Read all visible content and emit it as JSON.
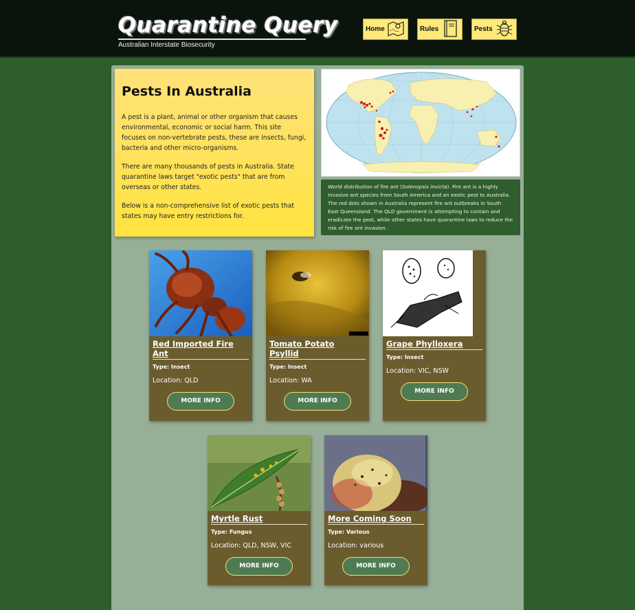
{
  "header": {
    "title": "Quarantine Query",
    "subtitle": "Australian Interstate Biosecurity",
    "nav": [
      {
        "label": "Home",
        "icon": "map-icon"
      },
      {
        "label": "Rules",
        "icon": "book-icon"
      },
      {
        "label": "Pests",
        "icon": "bug-icon"
      }
    ]
  },
  "intro": {
    "heading": "Pests In Australia",
    "paragraphs": [
      "A pest is a plant, animal or other organism that causes environmental, economic or social harm. This site focuses on non-vertebrate pests, these are insects, fungi, bacteria and other micro-organisms.",
      "There are many thousands of pests in Australia. State quarantine laws target \"exotic pests\" that are from overseas or other states.",
      "Below is a non-comprehensive list of exotic pests that states may have entry restrictions for."
    ]
  },
  "map": {
    "caption_before": "World distribution of fire ant (",
    "caption_species": "Solenopsis invicta",
    "caption_after": "). Fire ant is a highly invasive ant species from South America and an exotic pest to Australia. The red dots shown in Australia represent fire ant outbreaks in South East Queensland. The QLD government is attempting to contain and eradicate the pest, while other states have quarantine laws to reduce the risk of fire ant invasion."
  },
  "pests": [
    {
      "name": "Red Imported Fire Ant",
      "type": "Type: Insect",
      "location": "Location: QLD",
      "button": "MORE INFO"
    },
    {
      "name": "Tomato Potato Psyllid",
      "type": "Type: Insect",
      "location": "Location: WA",
      "button": "MORE INFO"
    },
    {
      "name": "Grape Phylloxera",
      "type": "Type: Insect",
      "location": "Location: VIC, NSW",
      "button": "MORE INFO"
    },
    {
      "name": "Myrtle Rust",
      "type": "Type: Fungus",
      "location": "Location: QLD, NSW, VIC",
      "button": "MORE INFO"
    },
    {
      "name": "More Coming Soon",
      "type": "Type: Various",
      "location": "Location: various",
      "button": "MORE INFO"
    }
  ],
  "colors": {
    "header_bg": "#0b140c",
    "page_bg": "#2d5e2b",
    "panel_bg": "#97ae97",
    "card_bg": "#6b5c2e",
    "nav_button": "#ffe97a",
    "button_bg": "#4f7b52",
    "button_border": "#f6e27a"
  }
}
